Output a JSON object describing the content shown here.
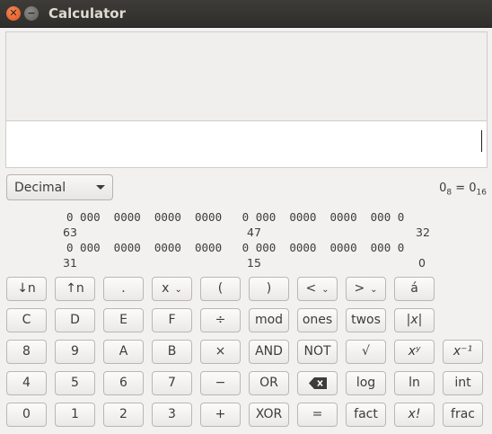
{
  "window": {
    "title": "Calculator"
  },
  "display": {
    "history": "",
    "entry": ""
  },
  "mode": {
    "selected": "Decimal"
  },
  "conversion": {
    "left": "0",
    "left_base": "8",
    "eq": "=",
    "right": "0",
    "right_base": "16"
  },
  "bits": {
    "row1": "0 000  0000  0000  0000   0 000  0000  0000  000 0",
    "row2": "0 000  0000  0000  0000   0 000  0000  0000  000 0",
    "idx": [
      "63",
      "47",
      "32",
      "31",
      "15",
      "0"
    ]
  },
  "buttons": {
    "row1": [
      "↓n",
      "↑n",
      ".",
      "x",
      "(",
      ")",
      "<",
      ">",
      "á"
    ],
    "row2": [
      "C",
      "D",
      "E",
      "F",
      "÷",
      "mod",
      "ones",
      "twos",
      "|x|"
    ],
    "row3": [
      "8",
      "9",
      "A",
      "B",
      "×",
      "AND",
      "NOT",
      "√",
      "xʸ",
      "x⁻¹"
    ],
    "row4": [
      "4",
      "5",
      "6",
      "7",
      "−",
      "OR",
      "⌫",
      "log",
      "ln",
      "int"
    ],
    "row5": [
      "0",
      "1",
      "2",
      "3",
      "+",
      "XOR",
      "=",
      "fact",
      "x!",
      "frac"
    ]
  },
  "icons": {
    "close": "close-icon",
    "minimize": "minimize-icon",
    "backspace": "backspace-icon"
  }
}
